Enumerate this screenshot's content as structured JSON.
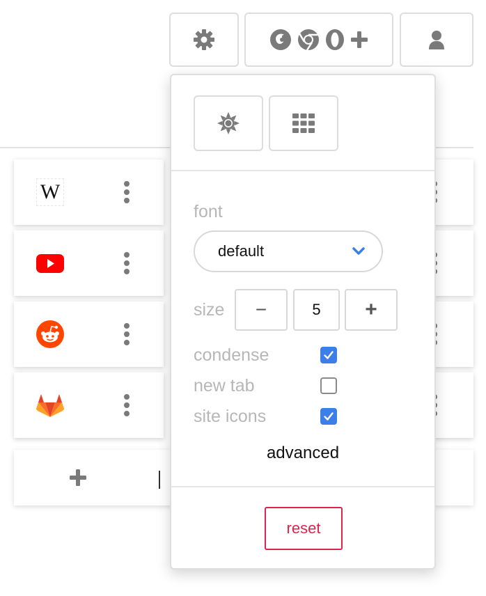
{
  "icons": {
    "settings": "gear-icon",
    "browsers": [
      "firefox-icon",
      "chrome-icon",
      "opera-icon",
      "plus-icon"
    ],
    "account": "user-icon",
    "theme": "sun-icon",
    "layout": "grid-icon",
    "add": "plus-icon",
    "item_menu": "more-vertical-icon"
  },
  "bookmarks": [
    {
      "name": "Wikipedia",
      "logo_text": "W",
      "icon": "wikipedia-logo"
    },
    {
      "name": "YouTube",
      "icon": "youtube-logo"
    },
    {
      "name": "Reddit",
      "icon": "reddit-logo"
    },
    {
      "name": "GitLab",
      "icon": "gitlab-logo"
    }
  ],
  "settings_panel": {
    "font": {
      "label": "font",
      "value": "default"
    },
    "size": {
      "label": "size",
      "decrease_label": "−",
      "value": "5",
      "increase_label": "+"
    },
    "options": [
      {
        "label": "condense",
        "checked": true
      },
      {
        "label": "new tab",
        "checked": false
      },
      {
        "label": "site icons",
        "checked": true
      }
    ],
    "advanced_label": "advanced",
    "reset_label": "reset"
  },
  "colors": {
    "accent_blue": "#3d7fe6",
    "reset_red": "#e0234d",
    "icon_gray": "#7a7a7a",
    "label_gray": "#b7b7b7"
  }
}
